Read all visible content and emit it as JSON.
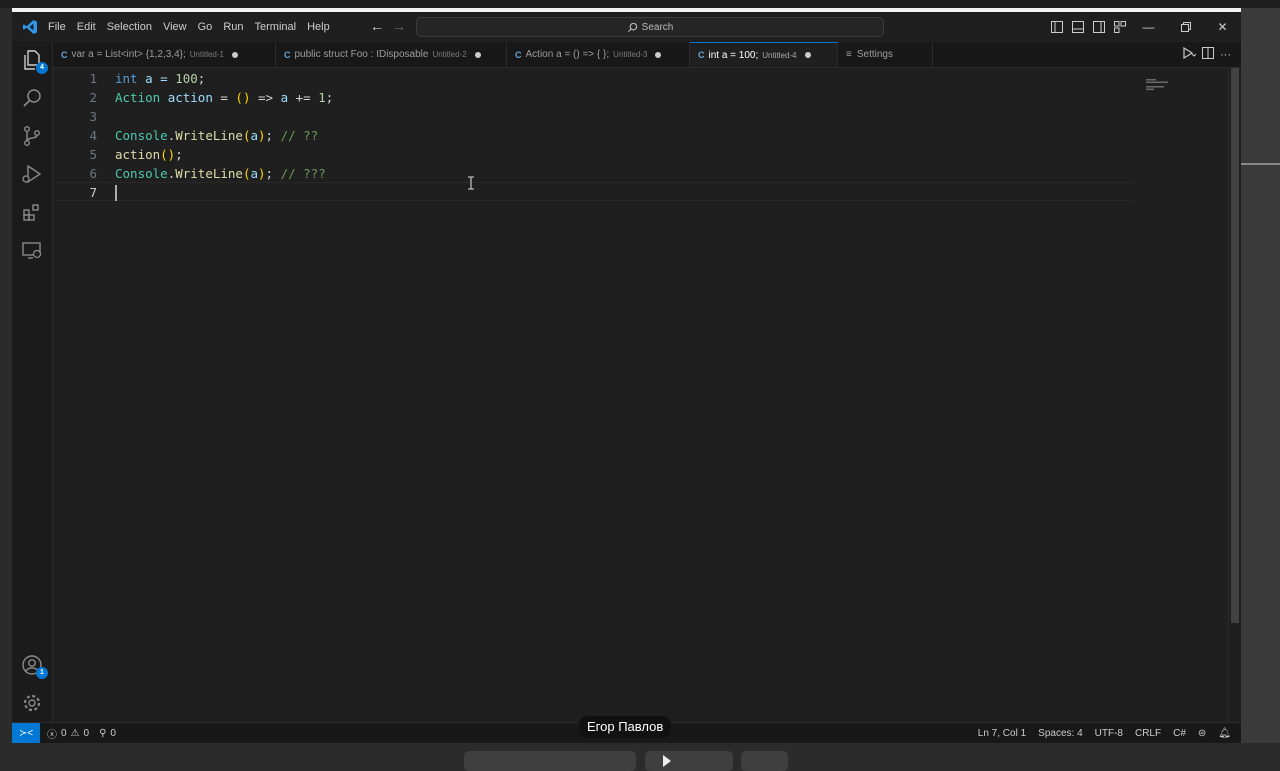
{
  "menu": [
    "File",
    "Edit",
    "Selection",
    "View",
    "Go",
    "Run",
    "Terminal",
    "Help"
  ],
  "search": {
    "label": "Search"
  },
  "activity": {
    "explorer_badge": "4",
    "accounts_badge": "1"
  },
  "tabs": [
    {
      "label": "var a = List<int> {1,2,3,4};",
      "desc": "Untitled-1",
      "active": false
    },
    {
      "label": "public struct Foo : IDisposable",
      "desc": "Untitled-2",
      "active": false
    },
    {
      "label": "Action a = () => { };",
      "desc": "Untitled-3",
      "active": false
    },
    {
      "label": "int a = 100;",
      "desc": "Untitled-4",
      "active": true
    },
    {
      "label": "Settings",
      "desc": "",
      "active": false
    }
  ],
  "editor": {
    "line_numbers": [
      "1",
      "2",
      "3",
      "4",
      "5",
      "6",
      "7"
    ],
    "lines": [
      [
        {
          "t": "int",
          "c": "kw"
        },
        {
          "t": " a = ",
          "c": "var"
        },
        {
          "t": "100",
          "c": "num"
        },
        {
          "t": ";",
          "c": "pu"
        }
      ],
      [
        {
          "t": "Action",
          "c": "ty"
        },
        {
          "t": " ",
          "c": "pu"
        },
        {
          "t": "action",
          "c": "var"
        },
        {
          "t": " = ",
          "c": "op"
        },
        {
          "t": "()",
          "c": "br"
        },
        {
          "t": " => ",
          "c": "op"
        },
        {
          "t": "a",
          "c": "var"
        },
        {
          "t": " += ",
          "c": "op"
        },
        {
          "t": "1",
          "c": "num"
        },
        {
          "t": ";",
          "c": "pu"
        }
      ],
      [],
      [
        {
          "t": "Console",
          "c": "ty"
        },
        {
          "t": ".",
          "c": "pu"
        },
        {
          "t": "WriteLine",
          "c": "fn"
        },
        {
          "t": "(",
          "c": "br"
        },
        {
          "t": "a",
          "c": "var"
        },
        {
          "t": ")",
          "c": "br"
        },
        {
          "t": "; ",
          "c": "pu"
        },
        {
          "t": "// ??",
          "c": "cm"
        }
      ],
      [
        {
          "t": "action",
          "c": "fn"
        },
        {
          "t": "()",
          "c": "br"
        },
        {
          "t": ";",
          "c": "pu"
        }
      ],
      [
        {
          "t": "Console",
          "c": "ty"
        },
        {
          "t": ".",
          "c": "pu"
        },
        {
          "t": "WriteLine",
          "c": "fn"
        },
        {
          "t": "(",
          "c": "br"
        },
        {
          "t": "a",
          "c": "var"
        },
        {
          "t": ")",
          "c": "br"
        },
        {
          "t": "; ",
          "c": "pu"
        },
        {
          "t": "// ???",
          "c": "cm"
        }
      ],
      []
    ]
  },
  "status": {
    "errors": "0",
    "warnings": "0",
    "ports": "0",
    "position": "Ln 7, Col 1",
    "spaces": "Spaces: 4",
    "encoding": "UTF-8",
    "eol": "CRLF",
    "language": "C#"
  },
  "overlay": {
    "speaker_name": "Егор Павлов"
  },
  "colors": {
    "accent": "#0078d4",
    "background": "#1f1f1f"
  }
}
